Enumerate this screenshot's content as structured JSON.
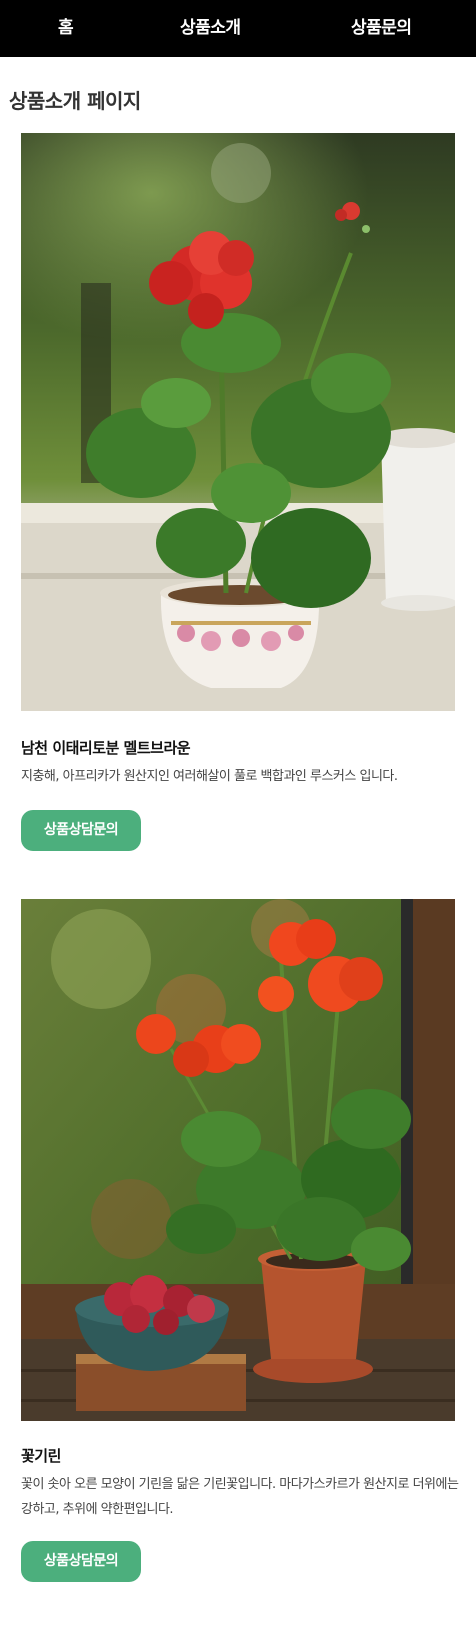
{
  "nav": {
    "home": "홈",
    "products": "상품소개",
    "inquiry": "상품문의"
  },
  "page_title": "상품소개 페이지",
  "products": [
    {
      "name": "남천 이태리토분 멜트브라운",
      "description": "지충해, 아프리카가 원산지인 여러해살이 풀로 백합과인 루스커스 입니다.",
      "button_label": "상품상담문의",
      "image_icon": "red-geranium-in-teacup-photo"
    },
    {
      "name": "꽃기린",
      "description": "꽃이 솟아 오른 모양이 기린을 닮은 기린꽃입니다. 마다가스카르가 원산지로 더위에는 강하고, 추위에 약한편입니다.",
      "button_label": "상품상담문의",
      "image_icon": "orange-geranium-in-terracotta-pot-photo"
    }
  ],
  "colors": {
    "nav_bg": "#000000",
    "button_bg": "#4caf7d"
  }
}
